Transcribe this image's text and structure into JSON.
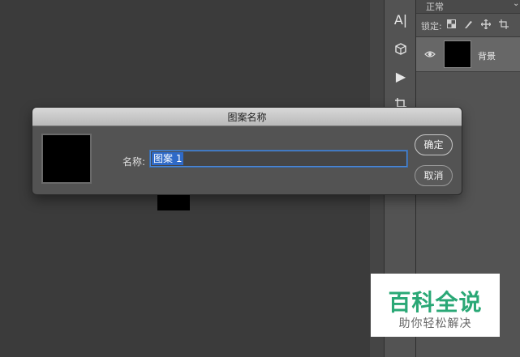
{
  "layers": {
    "blend_mode": "正常",
    "lock_label": "锁定:",
    "layer_name": "背景"
  },
  "dialog": {
    "title": "图案名称",
    "name_label": "名称:",
    "name_value": "图案 1",
    "ok_label": "确定",
    "cancel_label": "取消"
  },
  "tools": {
    "type_tool_glyph": "A|",
    "play_glyph": "▶"
  },
  "watermark": {
    "brand": "百科全说",
    "tagline": "助你轻松解决"
  },
  "colors": {
    "selection": "#2f6ac8",
    "input_focus": "#4b87d6",
    "watermark_green": "#2aa876"
  }
}
